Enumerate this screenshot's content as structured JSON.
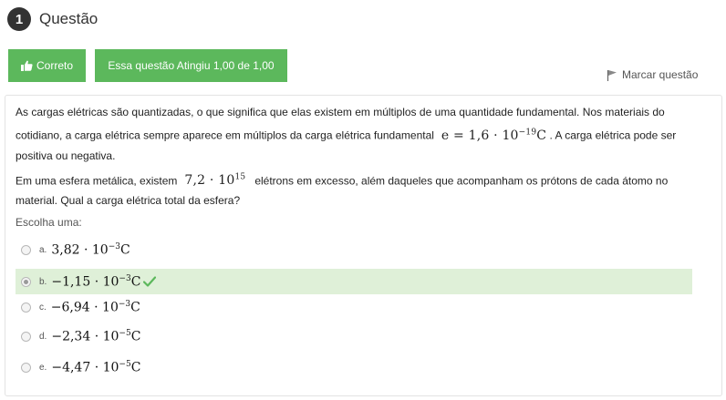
{
  "question": {
    "number": "1",
    "title": "Questão"
  },
  "status": {
    "correct_label": "Correto",
    "grade_label": "Essa questão Atingiu 1,00 de 1,00"
  },
  "flag": {
    "label": "Marcar questão",
    "icon": "flag-icon"
  },
  "text": {
    "p1_before": "As cargas elétricas são quantizadas, o que significa que elas existem em múltiplos de uma quantidade fundamental. Nos materiais do cotidiano, a carga elétrica sempre aparece em múltiplos da carga elétrica fundamental",
    "p1_formula_base": "e = 1,6 · 10",
    "p1_formula_exp": "−19",
    "p1_formula_unit": "C",
    "p1_after": ". A carga elétrica pode ser positiva ou negativa.",
    "p2_prefix": "Em uma esfera metálica, existem",
    "p2_formula_base": "7,2 · 10",
    "p2_formula_exp": "15",
    "p2_after": "elétrons em excesso, além daqueles que acompanham os prótons de cada átomo no material. Qual a carga elétrica total da esfera?"
  },
  "choose_label": "Escolha uma:",
  "answers": [
    {
      "letter": "a.",
      "mantissa": "3,82 · 10",
      "exp": "−3",
      "unit": "C"
    },
    {
      "letter": "b.",
      "mantissa": "−1,15 · 10",
      "exp": "−3",
      "unit": "C"
    },
    {
      "letter": "c.",
      "mantissa": "−6,94 · 10",
      "exp": "−3",
      "unit": "C"
    },
    {
      "letter": "d.",
      "mantissa": "−2,34 · 10",
      "exp": "−5",
      "unit": "C"
    },
    {
      "letter": "e.",
      "mantissa": "−4,47 · 10",
      "exp": "−5",
      "unit": "C"
    }
  ],
  "selected_answer": "b.",
  "colors": {
    "success": "#5cb85c",
    "selected_bg": "#dff0d8",
    "check": "#5cb85c"
  }
}
